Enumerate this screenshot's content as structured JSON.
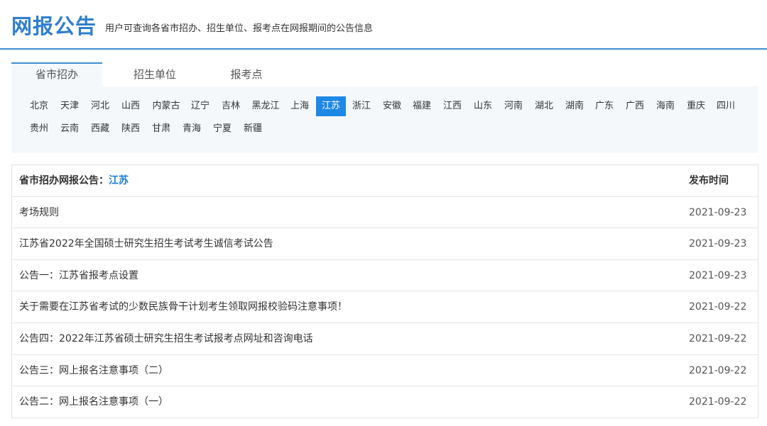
{
  "header": {
    "title": "网报公告",
    "subtitle": "用户可查询各省市招办、招生单位、报考点在网报期间的公告信息"
  },
  "tabs": [
    {
      "label": "省市招办",
      "active": true
    },
    {
      "label": "招生单位",
      "active": false
    },
    {
      "label": "报考点",
      "active": false
    }
  ],
  "provinces": [
    "北京",
    "天津",
    "河北",
    "山西",
    "内蒙古",
    "辽宁",
    "吉林",
    "黑龙江",
    "上海",
    "江苏",
    "浙江",
    "安徽",
    "福建",
    "江西",
    "山东",
    "河南",
    "湖北",
    "湖南",
    "广东",
    "广西",
    "海南",
    "重庆",
    "四川",
    "贵州",
    "云南",
    "西藏",
    "陕西",
    "甘肃",
    "青海",
    "宁夏",
    "新疆"
  ],
  "selected_province": "江苏",
  "table": {
    "header_label": "省市招办网报公告：",
    "header_province": "江苏",
    "date_header": "发布时间",
    "rows": [
      {
        "title": "考场规则",
        "date": "2021-09-23"
      },
      {
        "title": "江苏省2022年全国硕士研究生招生考试考生诚信考试公告",
        "date": "2021-09-23"
      },
      {
        "title": "公告一：江苏省报考点设置",
        "date": "2021-09-23"
      },
      {
        "title": "关于需要在江苏省考试的少数民族骨干计划考生领取网报校验码注意事项！",
        "date": "2021-09-22"
      },
      {
        "title": "公告四：2022年江苏省硕士研究生招生考试报考点网址和咨询电话",
        "date": "2021-09-22"
      },
      {
        "title": "公告三：网上报名注意事项（二）",
        "date": "2021-09-22"
      },
      {
        "title": "公告二：网上报名注意事项（一）",
        "date": "2021-09-22"
      }
    ]
  },
  "colors": {
    "accent": "#1e88e5",
    "title": "#2f7fcf",
    "panel_bg": "#f5f8fb"
  }
}
